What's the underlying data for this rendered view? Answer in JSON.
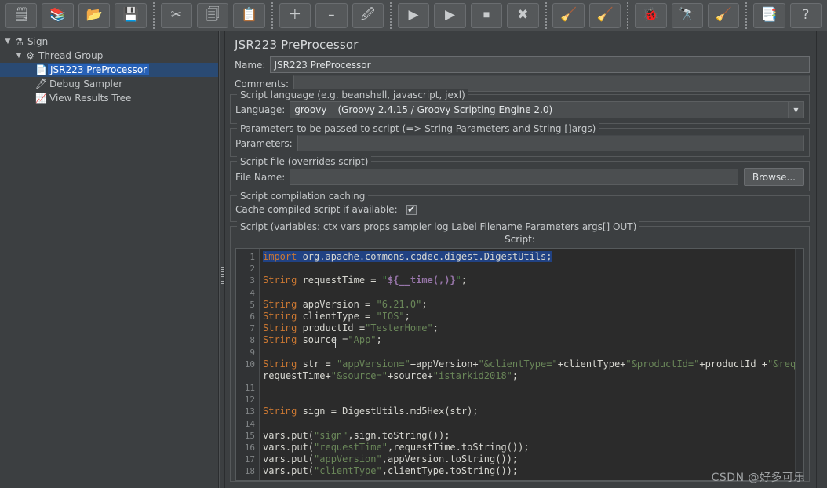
{
  "toolbar": {
    "items": [
      {
        "name": "new-button",
        "glyph": "🗒",
        "title": "New"
      },
      {
        "name": "templates-button",
        "glyph": "📚",
        "title": "Templates"
      },
      {
        "name": "open-button",
        "glyph": "📂",
        "title": "Open"
      },
      {
        "name": "save-button",
        "glyph": "💾",
        "title": "Save Test Plan"
      },
      {
        "name": "separator-1",
        "glyph": "",
        "title": "separator"
      },
      {
        "name": "cut-button",
        "glyph": "✂",
        "title": "Cut"
      },
      {
        "name": "copy-button",
        "glyph": "🗐",
        "title": "Copy"
      },
      {
        "name": "paste-button",
        "glyph": "📋",
        "title": "Paste"
      },
      {
        "name": "separator-2",
        "glyph": "",
        "title": "separator"
      },
      {
        "name": "expand-all-button",
        "glyph": "＋",
        "title": "Expand All"
      },
      {
        "name": "collapse-all-button",
        "glyph": "–",
        "title": "Collapse All"
      },
      {
        "name": "toggle-button",
        "glyph": "🖉",
        "title": "Toggle"
      },
      {
        "name": "separator-3",
        "glyph": "",
        "title": "separator"
      },
      {
        "name": "start-button",
        "glyph": "▶",
        "title": "Start"
      },
      {
        "name": "start-no-pauses-button",
        "glyph": "▶",
        "title": "Start no pauses"
      },
      {
        "name": "stop-button",
        "glyph": "⏹",
        "title": "Stop"
      },
      {
        "name": "shutdown-button",
        "glyph": "✖",
        "title": "Shutdown"
      },
      {
        "name": "separator-4",
        "glyph": "",
        "title": "separator"
      },
      {
        "name": "clear-button",
        "glyph": "🧹",
        "title": "Clear"
      },
      {
        "name": "clear-all-button",
        "glyph": "🧹",
        "title": "Clear All"
      },
      {
        "name": "separator-5",
        "glyph": "",
        "title": "separator"
      },
      {
        "name": "function-helper-button",
        "glyph": "🐞",
        "title": "Function Helper Dialog"
      },
      {
        "name": "search-button",
        "glyph": "🔭",
        "title": "Search"
      },
      {
        "name": "reset-search-button",
        "glyph": "🧹",
        "title": "Reset Search"
      },
      {
        "name": "separator-6",
        "glyph": "",
        "title": "separator"
      },
      {
        "name": "log-viewer-button",
        "glyph": "📑",
        "title": "Toggle Log Viewer"
      },
      {
        "name": "help-button",
        "glyph": "?",
        "title": "Help"
      }
    ]
  },
  "tree": {
    "items": [
      {
        "label": "Sign",
        "icon": "test-plan-icon",
        "glyph": "⚗",
        "twisty": "▼",
        "indent": 0,
        "selected": false
      },
      {
        "label": "Thread Group",
        "icon": "thread-group-icon",
        "glyph": "⚙",
        "twisty": "▼",
        "indent": 1,
        "selected": false
      },
      {
        "label": "JSR223 PreProcessor",
        "icon": "preprocessor-icon",
        "glyph": "📄",
        "twisty": "",
        "indent": 2,
        "selected": true
      },
      {
        "label": "Debug Sampler",
        "icon": "sampler-icon",
        "glyph": "🖊",
        "twisty": "",
        "indent": 2,
        "selected": false
      },
      {
        "label": "View Results Tree",
        "icon": "listener-icon",
        "glyph": "📈",
        "twisty": "",
        "indent": 2,
        "selected": false
      }
    ]
  },
  "panel": {
    "title": "JSR223 PreProcessor",
    "name_label": "Name:",
    "name_value": "JSR223 PreProcessor",
    "comments_label": "Comments:",
    "comments_value": "",
    "script_language_group": "Script language (e.g. beanshell, javascript, jexl)",
    "language_label": "Language:",
    "language_value": "groovy",
    "language_detail": "(Groovy 2.4.15 / Groovy Scripting Engine 2.0)",
    "combo_arrow": "▼",
    "parameters_group": "Parameters to be passed to script (=> String Parameters and String []args)",
    "parameters_label": "Parameters:",
    "parameters_value": "",
    "script_file_group": "Script file (overrides script)",
    "file_name_label": "File Name:",
    "file_name_value": "",
    "browse_label": "Browse...",
    "caching_group": "Script compilation caching",
    "cache_label": "Cache compiled script if available:",
    "cache_checked": "✔",
    "script_group": "Script (variables: ctx vars props sampler log Label Filename Parameters args[] OUT)",
    "script_sublabel": "Script:"
  },
  "editor": {
    "line_numbers": [
      "1",
      "2",
      "3",
      "4",
      "5",
      "6",
      "7",
      "8",
      "9",
      "10",
      "",
      "11",
      "12",
      "13",
      "14",
      "15",
      "16",
      "17",
      "18"
    ],
    "code_lines": [
      {
        "selected": true,
        "tokens": [
          {
            "t": "import ",
            "c": "kw"
          },
          {
            "t": "org.apache.commons.codec.digest.DigestUtils;",
            "c": "fn"
          }
        ]
      },
      {
        "selected": false,
        "tokens": []
      },
      {
        "selected": false,
        "tokens": [
          {
            "t": "String",
            "c": "kw"
          },
          {
            "t": " requestTime = ",
            "c": "fn"
          },
          {
            "t": "\"",
            "c": "st"
          },
          {
            "t": "${__time(,)}",
            "c": "var"
          },
          {
            "t": "\"",
            "c": "st"
          },
          {
            "t": ";",
            "c": "fn"
          }
        ]
      },
      {
        "selected": false,
        "tokens": []
      },
      {
        "selected": false,
        "tokens": [
          {
            "t": "String",
            "c": "kw"
          },
          {
            "t": " appVersion = ",
            "c": "fn"
          },
          {
            "t": "\"6.21.0\"",
            "c": "stv"
          },
          {
            "t": ";",
            "c": "fn"
          }
        ]
      },
      {
        "selected": false,
        "tokens": [
          {
            "t": "String",
            "c": "kw"
          },
          {
            "t": " clientType = ",
            "c": "fn"
          },
          {
            "t": "\"IOS\"",
            "c": "stv"
          },
          {
            "t": ";",
            "c": "fn"
          }
        ]
      },
      {
        "selected": false,
        "tokens": [
          {
            "t": "String",
            "c": "kw"
          },
          {
            "t": " productId =",
            "c": "fn"
          },
          {
            "t": "\"TesterHome\"",
            "c": "stv"
          },
          {
            "t": ";",
            "c": "fn"
          }
        ]
      },
      {
        "selected": false,
        "tokens": [
          {
            "t": "String",
            "c": "kw"
          },
          {
            "t": " source =",
            "c": "fn"
          },
          {
            "t": "\"App\"",
            "c": "stv"
          },
          {
            "t": ";",
            "c": "fn"
          }
        ]
      },
      {
        "selected": false,
        "tokens": []
      },
      {
        "selected": false,
        "tokens": [
          {
            "t": "String",
            "c": "kw"
          },
          {
            "t": " str = ",
            "c": "fn"
          },
          {
            "t": "\"appVersion=\"",
            "c": "stv"
          },
          {
            "t": "+appVersion+",
            "c": "fn"
          },
          {
            "t": "\"&clientType=\"",
            "c": "stv"
          },
          {
            "t": "+clientType+",
            "c": "fn"
          },
          {
            "t": "\"&productId=\"",
            "c": "stv"
          },
          {
            "t": "+productId +",
            "c": "fn"
          },
          {
            "t": "\"&requestTime=\"",
            "c": "stv"
          },
          {
            "t": " +",
            "c": "fn"
          }
        ]
      },
      {
        "selected": false,
        "tokens": [
          {
            "t": "requestTime+",
            "c": "fn"
          },
          {
            "t": "\"&source=\"",
            "c": "stv"
          },
          {
            "t": "+source+",
            "c": "fn"
          },
          {
            "t": "\"istarkid2018\"",
            "c": "stv"
          },
          {
            "t": ";",
            "c": "fn"
          }
        ]
      },
      {
        "selected": false,
        "tokens": []
      },
      {
        "selected": false,
        "tokens": []
      },
      {
        "selected": false,
        "tokens": [
          {
            "t": "String",
            "c": "kw"
          },
          {
            "t": " sign = DigestUtils.md5Hex(str);",
            "c": "fn"
          }
        ]
      },
      {
        "selected": false,
        "tokens": []
      },
      {
        "selected": false,
        "tokens": [
          {
            "t": "vars.put(",
            "c": "fn"
          },
          {
            "t": "\"sign\"",
            "c": "stv"
          },
          {
            "t": ",sign.toString());",
            "c": "fn"
          }
        ]
      },
      {
        "selected": false,
        "tokens": [
          {
            "t": "vars.put(",
            "c": "fn"
          },
          {
            "t": "\"requestTime\"",
            "c": "stv"
          },
          {
            "t": ",requestTime.toString());",
            "c": "fn"
          }
        ]
      },
      {
        "selected": false,
        "tokens": [
          {
            "t": "vars.put(",
            "c": "fn"
          },
          {
            "t": "\"appVersion\"",
            "c": "stv"
          },
          {
            "t": ",appVersion.toString());",
            "c": "fn"
          }
        ]
      },
      {
        "selected": false,
        "tokens": [
          {
            "t": "vars.put(",
            "c": "fn"
          },
          {
            "t": "\"clientType\"",
            "c": "stv"
          },
          {
            "t": ",clientType.toString());",
            "c": "fn"
          }
        ]
      }
    ]
  },
  "watermark": "CSDN @好多可乐",
  "colors": {
    "accent": "#2761b7",
    "panel_bg": "#3c3f41",
    "toolbar_bg": "#4a4d4f",
    "editor_bg": "#2b2b2b",
    "keyword": "#cc7832",
    "string": "#6a8759",
    "variable": "#9876aa",
    "selection": "#214283"
  }
}
